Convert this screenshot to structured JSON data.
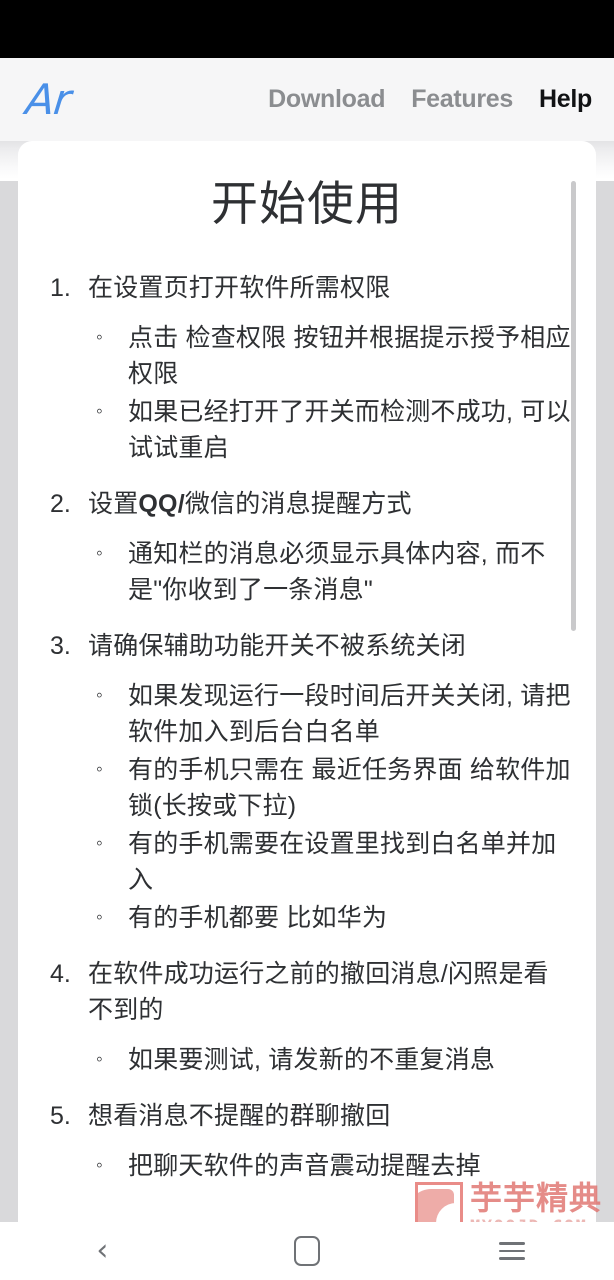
{
  "browser": {
    "brand_logo": "Ar",
    "nav": [
      {
        "label": "Download",
        "active": false
      },
      {
        "label": "Features",
        "active": false
      },
      {
        "label": "Help",
        "active": true
      }
    ]
  },
  "page": {
    "title": "开始使用",
    "steps": [
      {
        "number": "1.",
        "text": "在设置页打开软件所需权限",
        "subitems": [
          "点击 检查权限 按钮并根据提示授予相应权限",
          "如果已经打开了开关而检测不成功, 可以试试重启"
        ]
      },
      {
        "number": "2.",
        "text_prefix": "设置",
        "text_bold": "QQ/",
        "text_suffix": "微信的消息提醒方式",
        "subitems": [
          "通知栏的消息必须显示具体内容, 而不是\"你收到了一条消息\""
        ]
      },
      {
        "number": "3.",
        "text": "请确保辅助功能开关不被系统关闭",
        "subitems": [
          "如果发现运行一段时间后开关关闭, 请把软件加入到后台白名单",
          "有的手机只需在 最近任务界面 给软件加锁(长按或下拉)",
          "有的手机需要在设置里找到白名单并加入",
          "有的手机都要 比如华为"
        ]
      },
      {
        "number": "4.",
        "text": "在软件成功运行之前的撤回消息/闪照是看不到的",
        "subitems": [
          "如果要测试, 请发新的不重复消息"
        ]
      },
      {
        "number": "5.",
        "text": "想看消息不提醒的群聊撤回",
        "subitems": [
          "把聊天软件的声音震动提醒去掉"
        ]
      }
    ]
  },
  "watermark": {
    "cn": "芋芋精典",
    "en": "MYQQJD.COM"
  },
  "navbar": {
    "back": "‹",
    "home": "home",
    "recents": "recents"
  },
  "colors": {
    "brand": "#4a90e8",
    "text": "#2e3033",
    "nav_inactive": "#8b8d90",
    "nav_active": "#111214",
    "watermark": "#e0736f"
  }
}
